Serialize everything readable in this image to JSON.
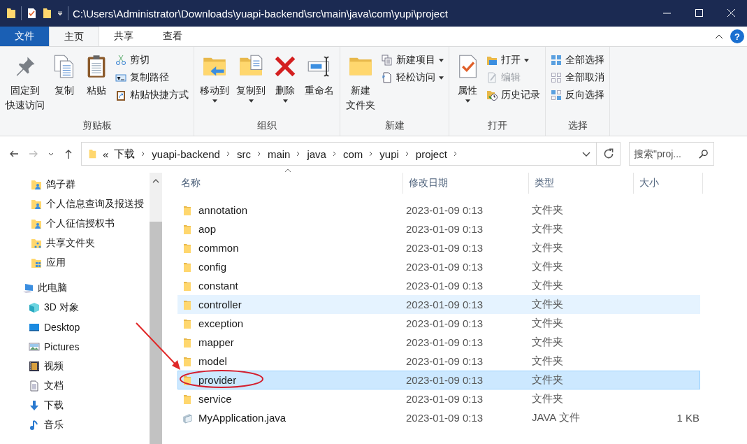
{
  "window": {
    "title": "C:\\Users\\Administrator\\Downloads\\yuapi-backend\\src\\main\\java\\com\\yupi\\project"
  },
  "ribbon_tabs": [
    {
      "label": "文件",
      "kind": "file"
    },
    {
      "label": "主页",
      "kind": "tab",
      "selected": true
    },
    {
      "label": "共享",
      "kind": "tab",
      "selected": false
    },
    {
      "label": "查看",
      "kind": "tab",
      "selected": false
    }
  ],
  "help_button": "?",
  "ribbon_groups": [
    {
      "label": "剪贴板",
      "big": [
        {
          "lines": [
            "固定到",
            "快速访问"
          ],
          "has_menu": false
        },
        {
          "label": "复制",
          "has_menu": false
        },
        {
          "label": "粘贴",
          "has_menu": false
        }
      ],
      "small": [
        {
          "label": "剪切",
          "has_menu": false,
          "disabled": false
        },
        {
          "label": "复制路径",
          "has_menu": false,
          "disabled": false
        },
        {
          "label": "粘贴快捷方式",
          "has_menu": false,
          "disabled": false
        }
      ]
    },
    {
      "label": "组织",
      "big": [
        {
          "label": "移动到",
          "has_menu": true
        },
        {
          "label": "复制到",
          "has_menu": true
        },
        {
          "label": "删除",
          "has_menu": true
        },
        {
          "label": "重命名",
          "has_menu": false
        }
      ]
    },
    {
      "label": "新建",
      "big": [
        {
          "lines": [
            "新建",
            "文件夹"
          ],
          "has_menu": false
        }
      ],
      "small": [
        {
          "label": "新建项目",
          "has_menu": true,
          "disabled": false
        },
        {
          "label": "轻松访问",
          "has_menu": true,
          "disabled": false
        }
      ]
    },
    {
      "label": "打开",
      "big": [
        {
          "label": "属性",
          "has_menu": true
        }
      ],
      "small": [
        {
          "label": "打开",
          "has_menu": true,
          "disabled": false
        },
        {
          "label": "编辑",
          "has_menu": false,
          "disabled": true
        },
        {
          "label": "历史记录",
          "has_menu": false,
          "disabled": false
        }
      ]
    },
    {
      "label": "选择",
      "small": [
        {
          "label": "全部选择",
          "has_menu": false,
          "disabled": false
        },
        {
          "label": "全部取消",
          "has_menu": false,
          "disabled": false
        },
        {
          "label": "反向选择",
          "has_menu": false,
          "disabled": false
        }
      ]
    }
  ],
  "address": {
    "overflow": "«",
    "crumbs": [
      "下载",
      "yuapi-backend",
      "src",
      "main",
      "java",
      "com",
      "yupi",
      "project"
    ]
  },
  "search": {
    "placeholder": "搜索\"proj..."
  },
  "sidebar": {
    "items": [
      {
        "label": "鸽子群"
      },
      {
        "label": "个人信息查询及报送授"
      },
      {
        "label": "个人征信授权书"
      },
      {
        "label": "共享文件夹"
      },
      {
        "label": "应用"
      },
      {
        "label": "此电脑",
        "children": [
          {
            "label": "3D 对象"
          },
          {
            "label": "Desktop"
          },
          {
            "label": "Pictures"
          },
          {
            "label": "视频"
          },
          {
            "label": "文档"
          },
          {
            "label": "下载"
          },
          {
            "label": "音乐"
          }
        ]
      }
    ]
  },
  "table": {
    "columns": [
      "名称",
      "修改日期",
      "类型",
      "大小"
    ],
    "rows": [
      {
        "kind": "folder",
        "name": "annotation",
        "modified": "2023-01-09 0:13",
        "type": "文件夹",
        "selected": false,
        "hovered": false
      },
      {
        "kind": "folder",
        "name": "aop",
        "modified": "2023-01-09 0:13",
        "type": "文件夹",
        "selected": false,
        "hovered": false
      },
      {
        "kind": "folder",
        "name": "common",
        "modified": "2023-01-09 0:13",
        "type": "文件夹",
        "selected": false,
        "hovered": false
      },
      {
        "kind": "folder",
        "name": "config",
        "modified": "2023-01-09 0:13",
        "type": "文件夹",
        "selected": false,
        "hovered": false
      },
      {
        "kind": "folder",
        "name": "constant",
        "modified": "2023-01-09 0:13",
        "type": "文件夹",
        "selected": false,
        "hovered": false
      },
      {
        "kind": "folder",
        "name": "controller",
        "modified": "2023-01-09 0:13",
        "type": "文件夹",
        "selected": false,
        "hovered": true
      },
      {
        "kind": "folder",
        "name": "exception",
        "modified": "2023-01-09 0:13",
        "type": "文件夹",
        "selected": false,
        "hovered": false
      },
      {
        "kind": "folder",
        "name": "mapper",
        "modified": "2023-01-09 0:13",
        "type": "文件夹",
        "selected": false,
        "hovered": false
      },
      {
        "kind": "folder",
        "name": "model",
        "modified": "2023-01-09 0:13",
        "type": "文件夹",
        "selected": false,
        "hovered": false
      },
      {
        "kind": "folder",
        "name": "provider",
        "modified": "2023-01-09 0:13",
        "type": "文件夹",
        "selected": true,
        "hovered": false
      },
      {
        "kind": "folder",
        "name": "service",
        "modified": "2023-01-09 0:13",
        "type": "文件夹",
        "selected": false,
        "hovered": false
      },
      {
        "kind": "file",
        "name": "MyApplication.java",
        "modified": "2023-01-09 0:13",
        "type": "JAVA 文件",
        "size": "1 KB",
        "selected": false,
        "hovered": false
      }
    ]
  }
}
